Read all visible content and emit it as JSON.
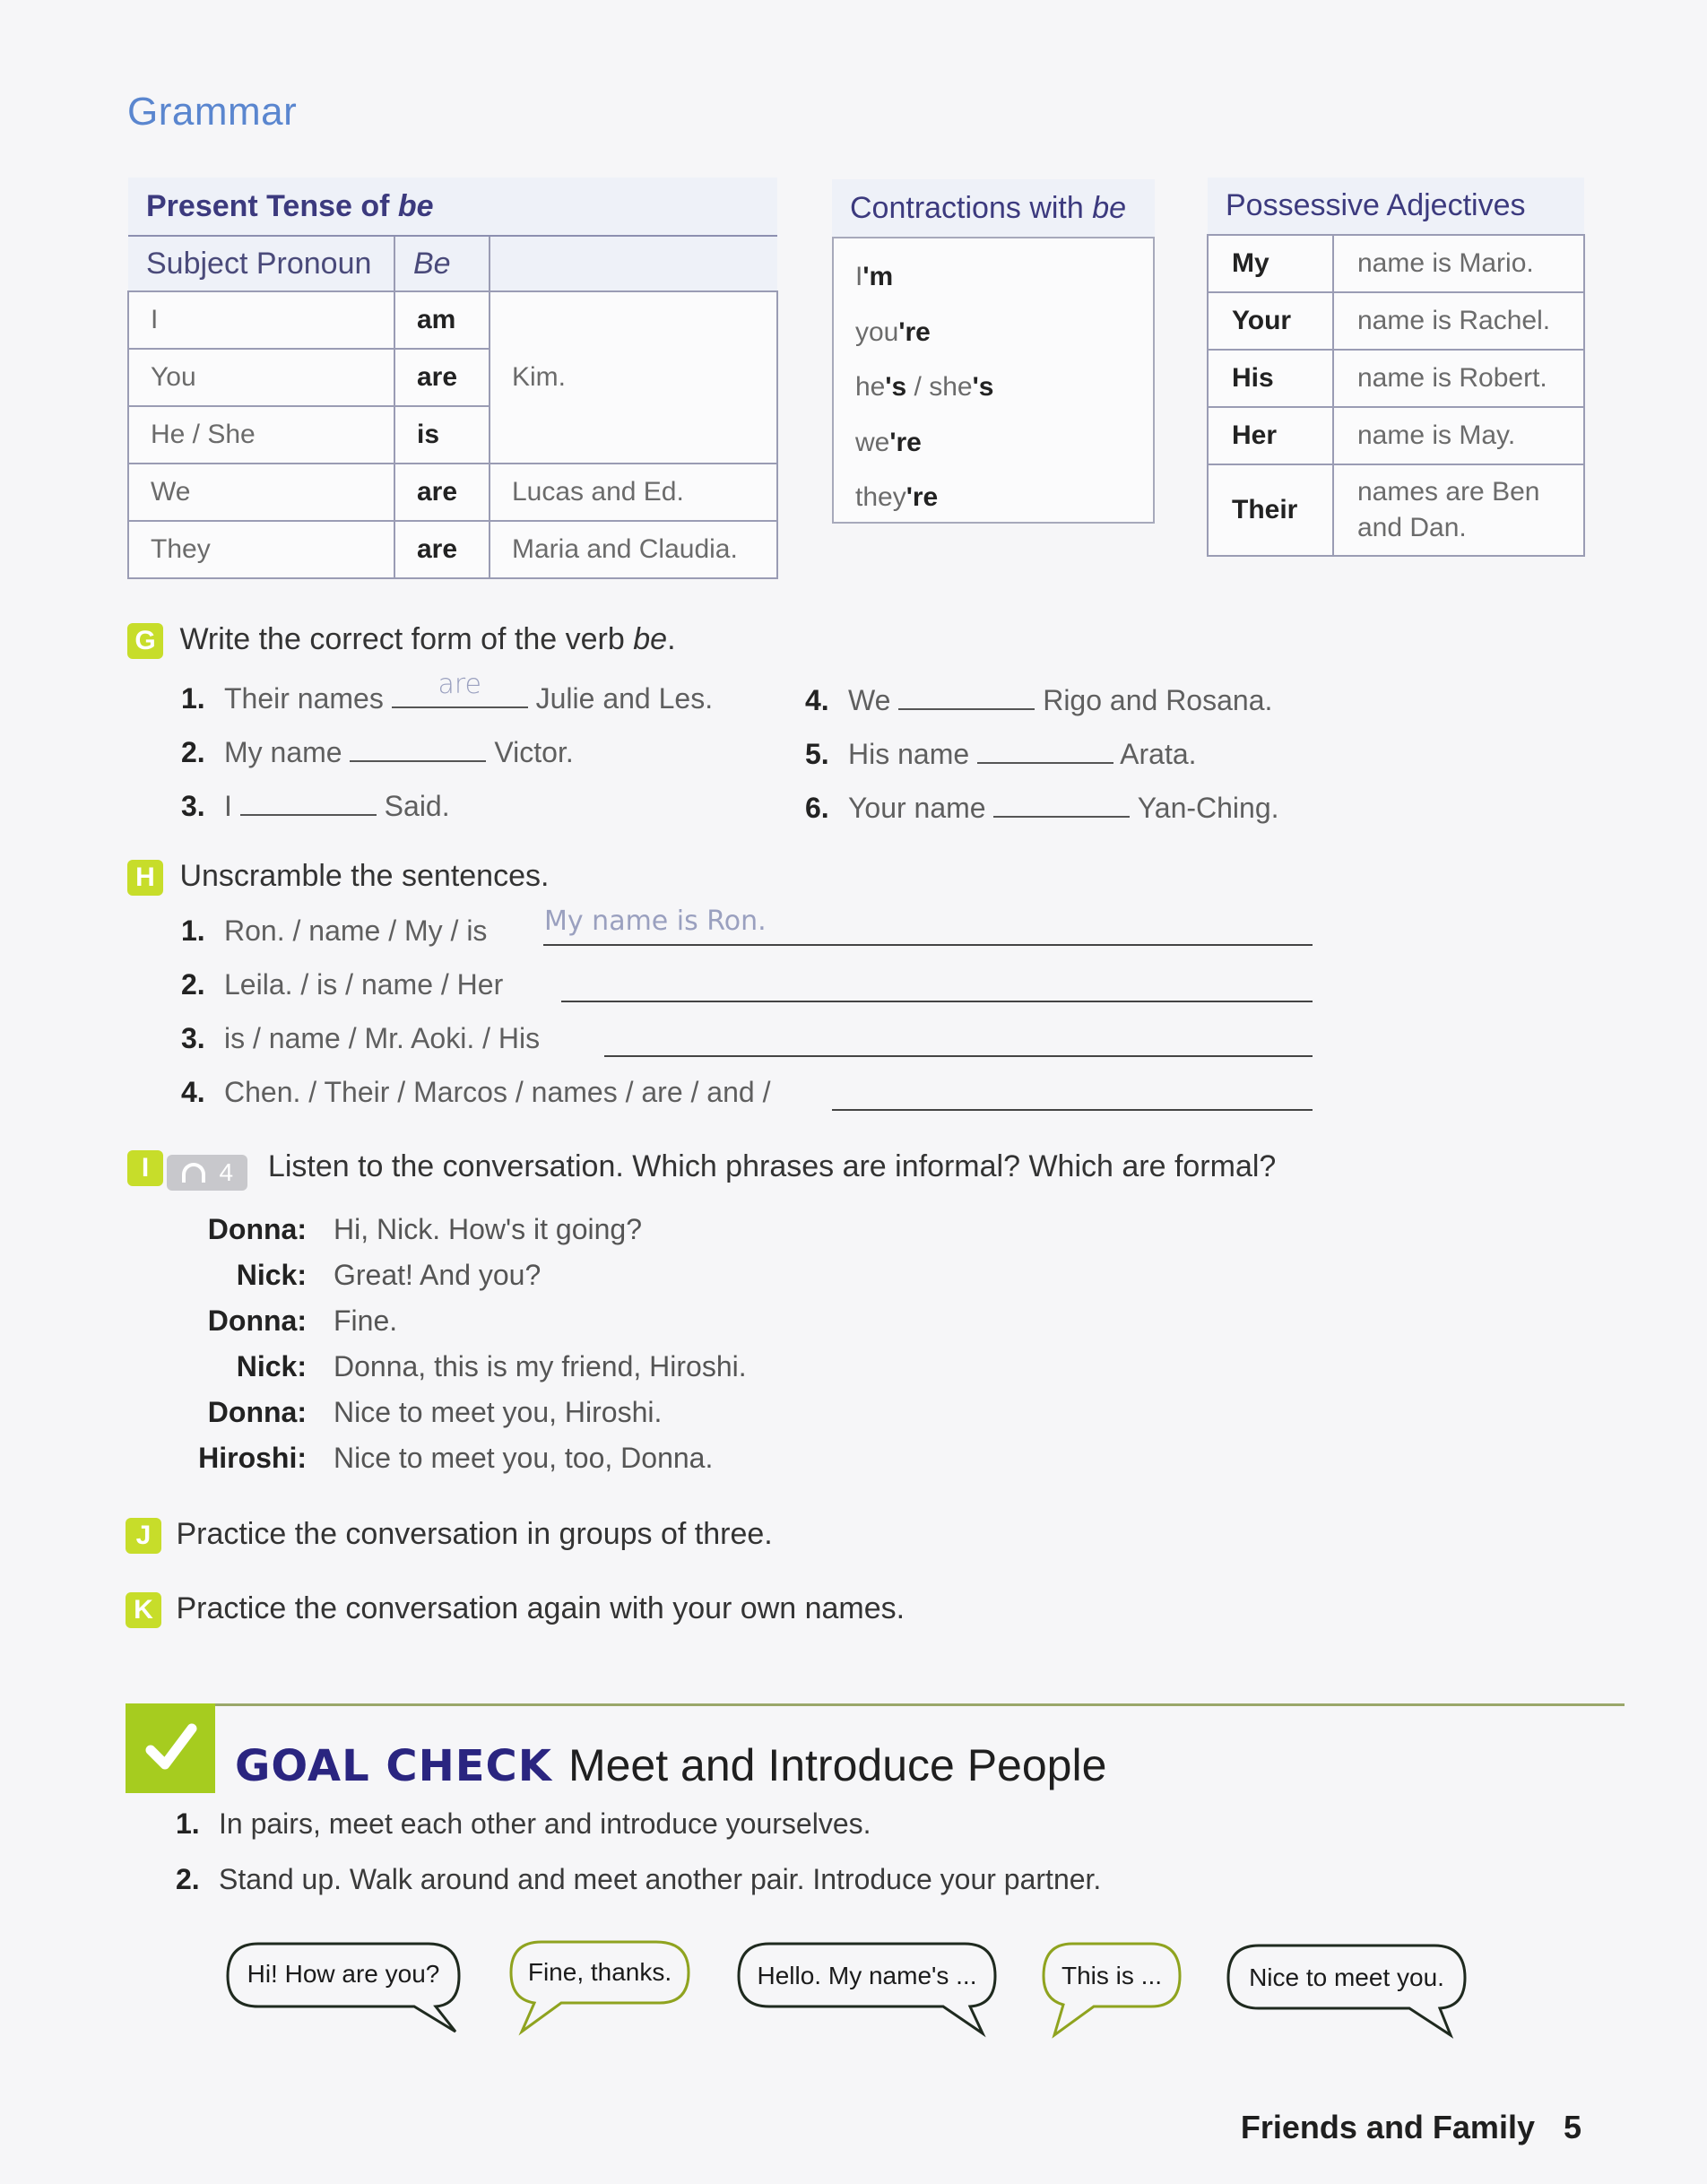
{
  "page": {
    "section_title": "Grammar",
    "footer_unit": "Friends and Family",
    "footer_page": "5"
  },
  "present_tense_table": {
    "title_prefix": "Present Tense of ",
    "title_italic": "be",
    "headers": [
      "Subject Pronoun",
      "Be",
      ""
    ],
    "rows": [
      {
        "pronoun": "I",
        "be": "am"
      },
      {
        "pronoun": "You",
        "be": "are"
      },
      {
        "pronoun": "He / She",
        "be": "is"
      },
      {
        "pronoun": "We",
        "be": "are",
        "complement": "Lucas and Ed."
      },
      {
        "pronoun": "They",
        "be": "are",
        "complement": "Maria and Claudia."
      }
    ],
    "merged_complement": "Kim."
  },
  "contractions_table": {
    "title_prefix": "Contractions with ",
    "title_italic": "be",
    "items": [
      {
        "base": "I",
        "suffix": "'m"
      },
      {
        "base": "you",
        "suffix": "'re"
      },
      {
        "base": "he",
        "suffix": "'s",
        "base2": " / she",
        "suffix2": "'s"
      },
      {
        "base": "we",
        "suffix": "'re"
      },
      {
        "base": "they",
        "suffix": "'re"
      }
    ]
  },
  "possessive_table": {
    "title": "Possessive Adjectives",
    "rows": [
      {
        "adj": "My",
        "text": "name is Mario."
      },
      {
        "adj": "Your",
        "text": "name is Rachel."
      },
      {
        "adj": "His",
        "text": "name is Robert."
      },
      {
        "adj": "Her",
        "text": "name is May."
      },
      {
        "adj": "Their",
        "text": "names are Ben and Dan."
      }
    ]
  },
  "activity_g": {
    "letter": "G",
    "instruction_prefix": "Write the correct form of the verb ",
    "instruction_italic": "be",
    "instruction_suffix": ".",
    "items": [
      {
        "num": "1.",
        "before": "Their names",
        "answer": "are",
        "after": "Julie and Les."
      },
      {
        "num": "2.",
        "before": "My name",
        "answer": "",
        "after": "Victor."
      },
      {
        "num": "3.",
        "before": "I",
        "answer": "",
        "after": "Said."
      },
      {
        "num": "4.",
        "before": "We",
        "answer": "",
        "after": "Rigo and Rosana."
      },
      {
        "num": "5.",
        "before": "His name",
        "answer": "",
        "after": "Arata."
      },
      {
        "num": "6.",
        "before": "Your name",
        "answer": "",
        "after": "Yan-Ching."
      }
    ]
  },
  "activity_h": {
    "letter": "H",
    "instruction": "Unscramble the sentences.",
    "items": [
      {
        "num": "1.",
        "prompt": "Ron. / name / My / is",
        "answer": "My name is Ron."
      },
      {
        "num": "2.",
        "prompt": "Leila. / is / name / Her",
        "answer": ""
      },
      {
        "num": "3.",
        "prompt": "is / name / Mr. Aoki. / His",
        "answer": ""
      },
      {
        "num": "4.",
        "prompt": "Chen. / Their / Marcos / names / are / and /",
        "answer": ""
      }
    ]
  },
  "activity_i": {
    "letter": "I",
    "audio_track": "4",
    "instruction": "Listen to the conversation. Which phrases are informal? Which are formal?",
    "conversation": [
      {
        "speaker": "Donna:",
        "line": "Hi, Nick. How's it going?"
      },
      {
        "speaker": "Nick:",
        "line": "Great! And you?"
      },
      {
        "speaker": "Donna:",
        "line": "Fine."
      },
      {
        "speaker": "Nick:",
        "line": "Donna, this is my friend, Hiroshi."
      },
      {
        "speaker": "Donna:",
        "line": "Nice to meet you, Hiroshi."
      },
      {
        "speaker": "Hiroshi:",
        "line": "Nice to meet you, too, Donna."
      }
    ]
  },
  "activity_j": {
    "letter": "J",
    "instruction": "Practice the conversation in groups of three."
  },
  "activity_k": {
    "letter": "K",
    "instruction": "Practice the conversation again with your own names."
  },
  "goal_check": {
    "label": "GOAL CHECK",
    "title": "Meet and Introduce People",
    "items": [
      {
        "num": "1.",
        "text": "In pairs, meet each other and introduce yourselves."
      },
      {
        "num": "2.",
        "text": "Stand up. Walk around and meet another pair. Introduce your partner."
      }
    ],
    "bubbles": [
      {
        "text": "Hi! How are you?",
        "color": "#1f2a1f"
      },
      {
        "text": "Fine, thanks.",
        "color": "#8fa31f"
      },
      {
        "text": "Hello. My name's ...",
        "color": "#1f2a1f"
      },
      {
        "text": "This is ...",
        "color": "#8fa31f"
      },
      {
        "text": "Nice to meet you.",
        "color": "#1f2a1f"
      }
    ]
  },
  "colors": {
    "accent_green": "#a6cc1f",
    "badge_green": "#c7dd2a",
    "heading_blue": "#5a86cf",
    "table_title_navy": "#3c3a7e",
    "goal_navy": "#2a2580"
  }
}
